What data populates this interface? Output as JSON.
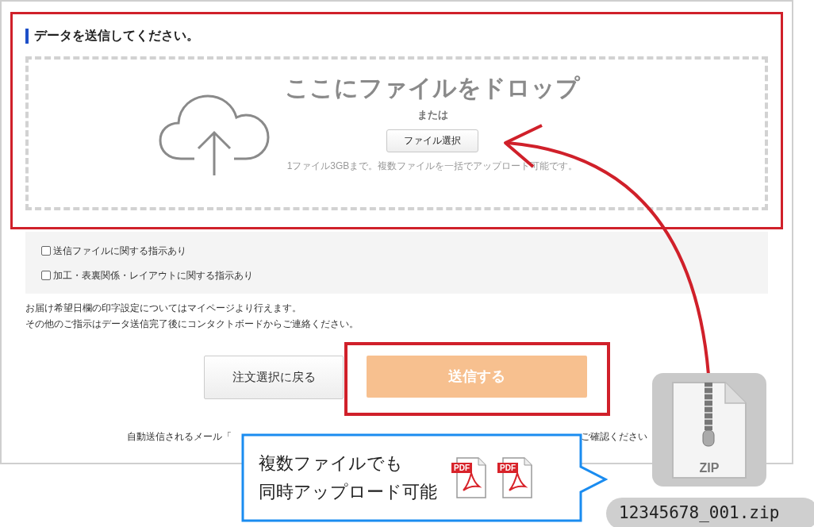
{
  "section": {
    "title": "データを送信してください。"
  },
  "dropzone": {
    "heading": "ここにファイルをドロップ",
    "or": "または",
    "button": "ファイル選択",
    "note": "1ファイル3GBまで。複数ファイルを一括でアップロード可能です。"
  },
  "options": [
    {
      "label": "送信ファイルに関する指示あり",
      "checked": false
    },
    {
      "label": "加工・表裏関係・レイアウトに関する指示あり",
      "checked": false
    }
  ],
  "info": [
    "お届け希望日欄の印字設定についてはマイページより行えます。",
    "その他のご指示はデータ送信完了後にコンタクトボードからご連絡ください。"
  ],
  "buttons": {
    "back": "注文選択に戻る",
    "submit": "送信する",
    "submit_disabled": true
  },
  "footer_note": [
    "自動送信されるメール「",
    "ご確認ください"
  ],
  "annotations": {
    "callout": [
      "複数ファイルでも",
      "同時アップロード可能"
    ],
    "pdf_icons": [
      "PDF",
      "PDF"
    ],
    "zip_label": "ZIP",
    "filename": "12345678_001.zip"
  }
}
